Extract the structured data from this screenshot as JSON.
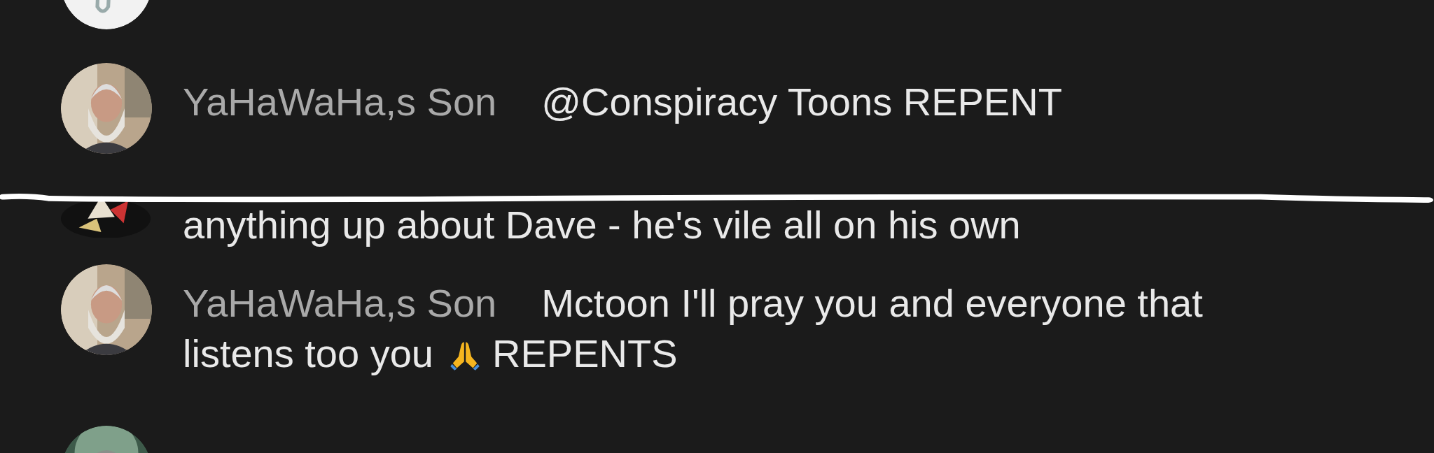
{
  "messages": [
    {
      "kind": "cut_top"
    },
    {
      "kind": "message",
      "author": "YaHaWaHa,s Son",
      "lines": [
        "@Conspiracy Toons REPENT"
      ]
    },
    {
      "kind": "covered",
      "text": "anything up about Dave - he's vile all on his own"
    },
    {
      "kind": "message",
      "author": "YaHaWaHa,s Son",
      "lines": [
        "Mctoon I'll pray you and everyone that",
        "listens too you"
      ],
      "after_emoji": "REPENTS"
    },
    {
      "kind": "cut_bottom"
    }
  ]
}
